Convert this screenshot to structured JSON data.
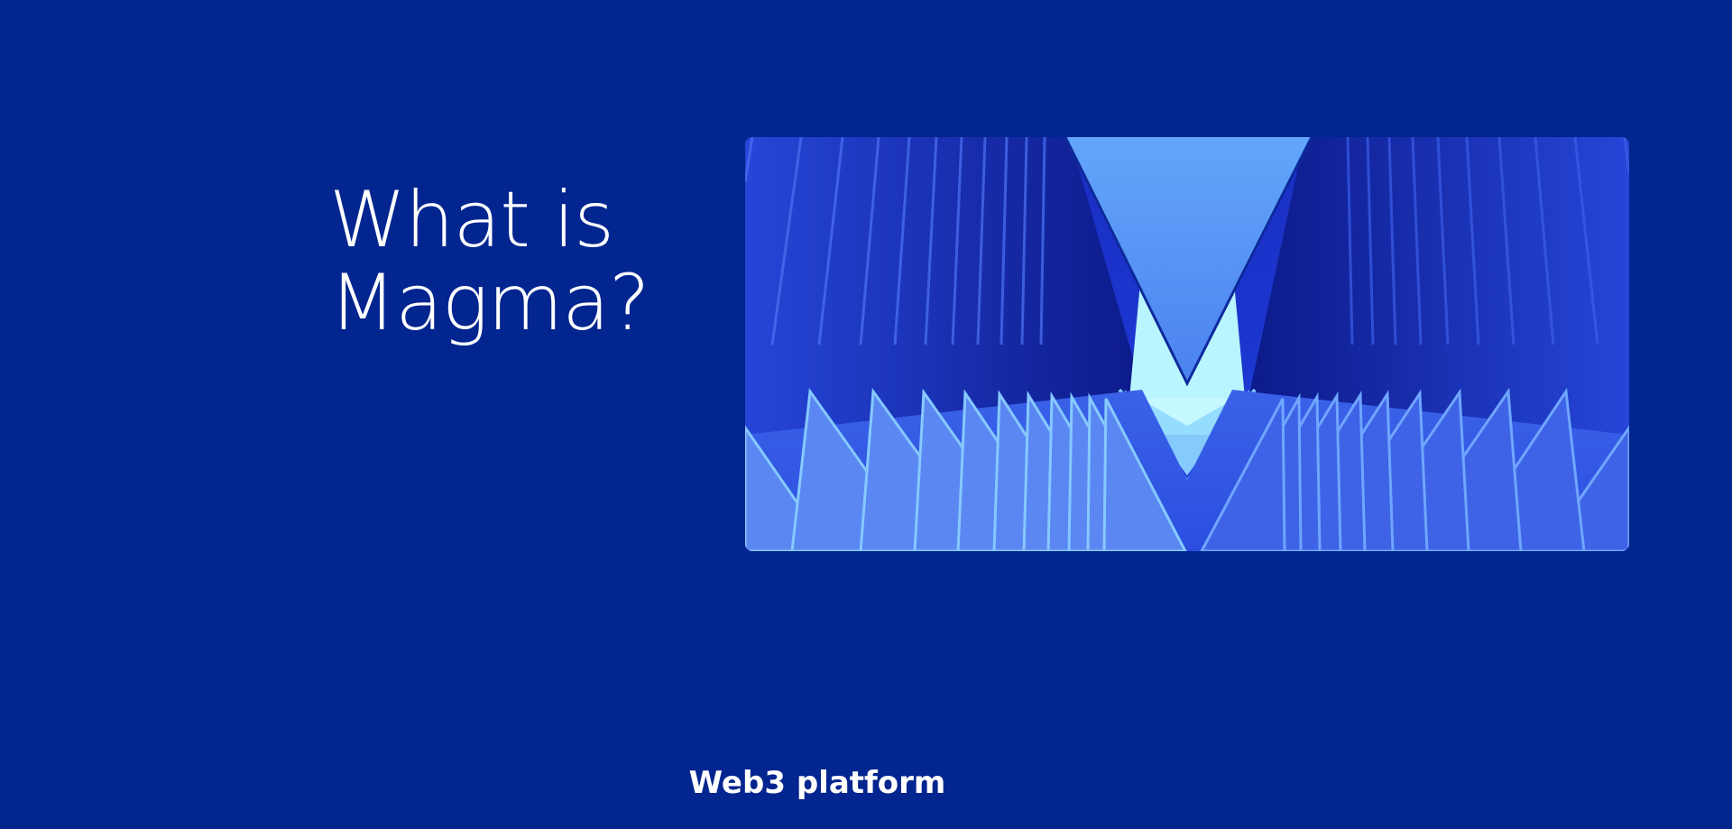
{
  "hero": {
    "title_line1": "What is",
    "title_line2": "Magma?"
  },
  "image": {
    "icon": "magma-logo-abstract-icon"
  },
  "footer": {
    "label": "Web3  platform"
  },
  "colors": {
    "background": "#02258f",
    "text": "#ffffff",
    "image_base": "#1f3ed6",
    "image_highlight": "#b8f6ff",
    "image_triangle": "#5b9cf6"
  }
}
